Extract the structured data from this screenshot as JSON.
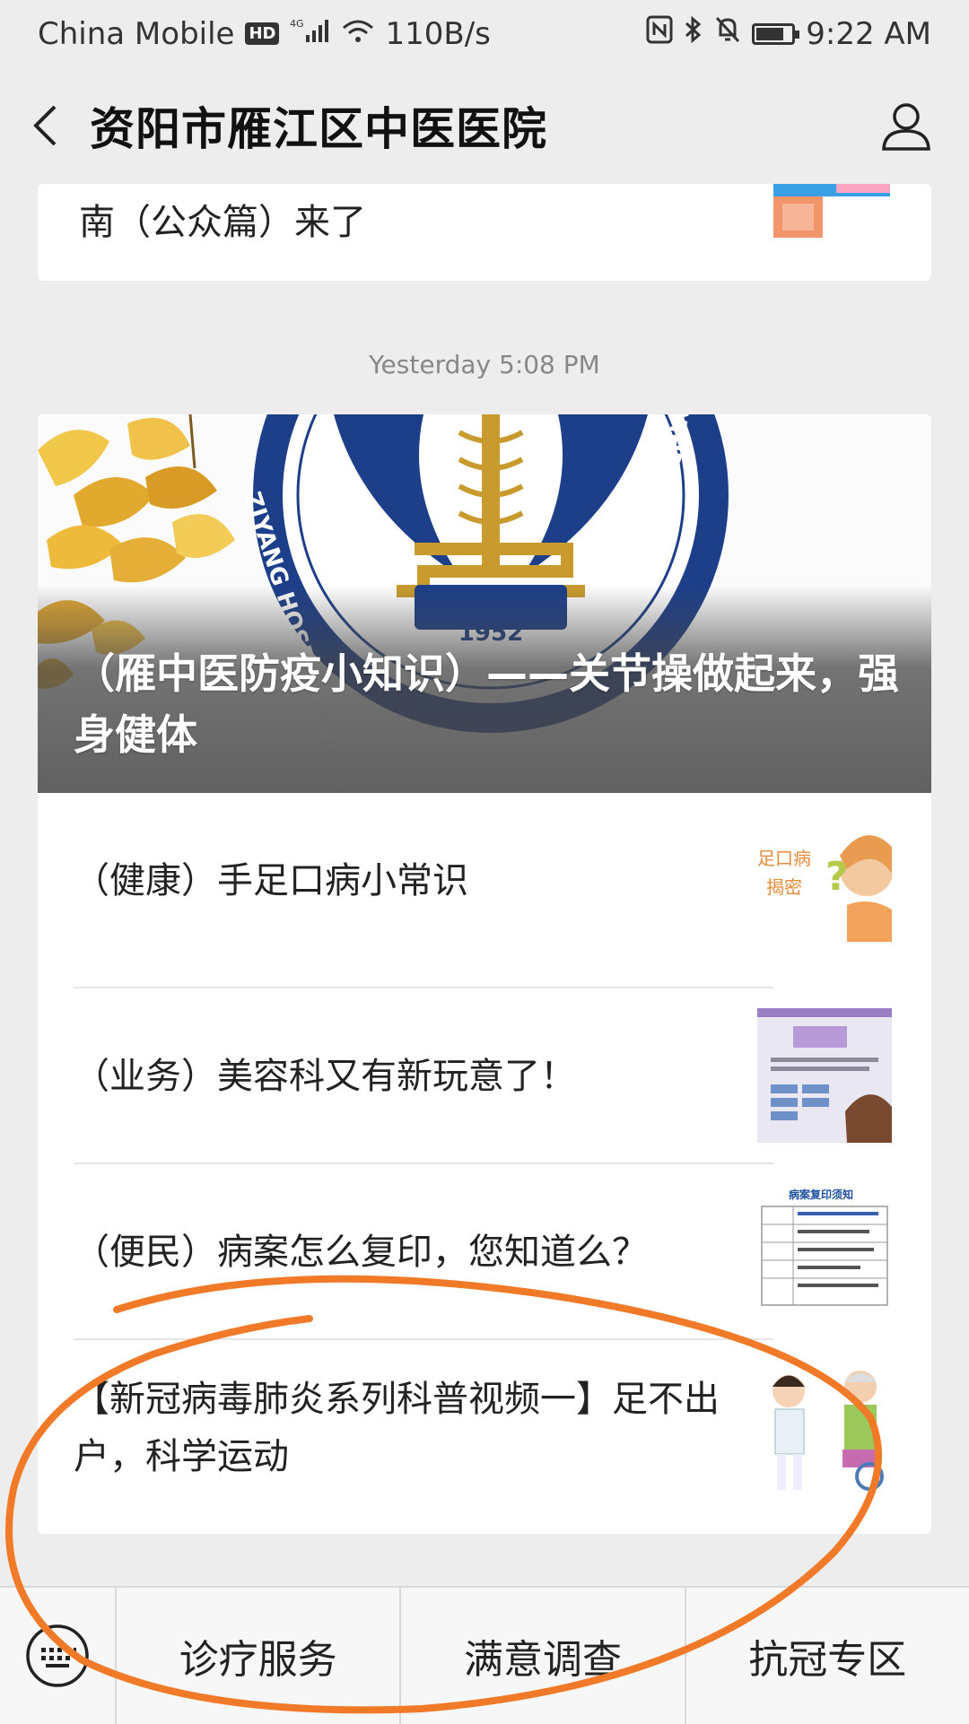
{
  "status_bar": {
    "carrier": "China Mobile",
    "hd_badge": "HD",
    "network": "4G",
    "speed": "110B/s",
    "time": "9:22 AM"
  },
  "header": {
    "title": "资阳市雁江区中医医院"
  },
  "top_card": {
    "title_fragment": "南（公众篇）来了"
  },
  "timestamp": "Yesterday 5:08 PM",
  "main_card": {
    "cover": {
      "title": "（雁中医防疫小知识）——关节操做起来，强身健体",
      "logo_text_left": "ZIYANG HOSPITAL OF TRADITIONAL",
      "logo_text_right": "CHINESE MEDICINE",
      "logo_year": "1952"
    },
    "articles": [
      {
        "title": "（健康）手足口病小常识",
        "thumb_text_1": "足口病",
        "thumb_text_2": "揭密"
      },
      {
        "title": "（业务）美容科又有新玩意了！"
      },
      {
        "title": "（便民）病案怎么复印，您知道么？",
        "thumb_text_1": "病案复印须知"
      },
      {
        "title": "【新冠病毒肺炎系列科普视频一】足不出户，科学运动"
      }
    ]
  },
  "bottom_menu": {
    "items": [
      "诊疗服务",
      "满意调查",
      "抗冠专区"
    ]
  },
  "colors": {
    "annotation_circle": "#f07a28",
    "logo_blue": "#1d3f8a",
    "logo_gold": "#c99a2e"
  }
}
